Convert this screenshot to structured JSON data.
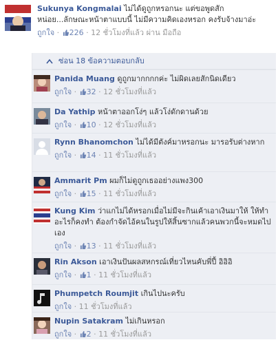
{
  "colors": {
    "link_blue": "#3b5998",
    "meta_gray": "#999999",
    "reply_bg": "#edeff4",
    "like_blue": "#6d84b4"
  },
  "top_comment": {
    "author": "Sukunya Kongmalai",
    "text": "ไม่ได้ดูถูกหรอกนะ แต่ขอพูดสักหน่อย...ลักษณะหน้าตาแบบนี้ ไม่มีความคิดเองหรอก คงรับจ้างมาอ่ะ",
    "like_label": "ถูกใจ",
    "like_count": "226",
    "time": "12 ชั่วโมงที่แล้ว",
    "via": "ผ่าน มือถือ"
  },
  "hide_replies": {
    "label": "ซ่อน 18 ข้อความตอบกลับ"
  },
  "replies": [
    {
      "author": "Panida Muang",
      "text": "ดูถูกมากกกกค่ะ ไม่ผิดเลยสักนิดเดียว",
      "like_label": "ถูกใจ",
      "like_count": "32",
      "time": "12 ชั่วโมงที่แล้ว"
    },
    {
      "author": "Da Yathip",
      "text": "หน้าตาออกโง่ๆ แล้วโง่ดักดานด้วย",
      "like_label": "ถูกใจ",
      "like_count": "10",
      "time": "12 ชั่วโมงที่แล้ว"
    },
    {
      "author": "Rynn Bhanomchon",
      "text": "ไม่ได้มีตังค์มาหรอกนะ มารอรับต่างหาก",
      "like_label": "ถูกใจ",
      "like_count": "14",
      "time": "11 ชั่วโมงที่แล้ว"
    },
    {
      "author": "Ammarit Pm",
      "text": "ผมก็ไม่ดูถูกเธออย่างแพง300",
      "like_label": "ถูกใจ",
      "like_count": "15",
      "time": "11 ชั่วโมงที่แล้ว"
    },
    {
      "author": "Kung Kim",
      "text": "ว่าแกไม่ได้หรอกเมื่อไม่มีจะกินเค้าเอาเงินมาให้ ให้ทำอะไรก็คงทำ ต้องกำจัดไอ้คนในรูปให้สิ้นซากแล้วคนพวกนี้จะหมดไปเอง",
      "like_label": "ถูกใจ",
      "like_count": "13",
      "time": "11 ชั่วโมงที่แล้ว"
    },
    {
      "author": "Rin Akson",
      "text": "เอาเงินปันผลสหกรณ์เที่ยวไหนคับพี่ปี้ อิอิอิ",
      "like_label": "ถูกใจ",
      "like_count": "1",
      "time": "11 ชั่วโมงที่แล้ว"
    },
    {
      "author": "Phumpetch Roumjit",
      "text": "เกินไปนะครับ",
      "like_label": "ถูกใจ",
      "like_count": "",
      "time": "11 ชั่วโมงที่แล้ว"
    },
    {
      "author": "Nupin Satakram",
      "text": "ไม่เกินหรอก",
      "like_label": "ถูกใจ",
      "like_count": "2",
      "time": "11 ชั่วโมงที่แล้ว"
    }
  ]
}
